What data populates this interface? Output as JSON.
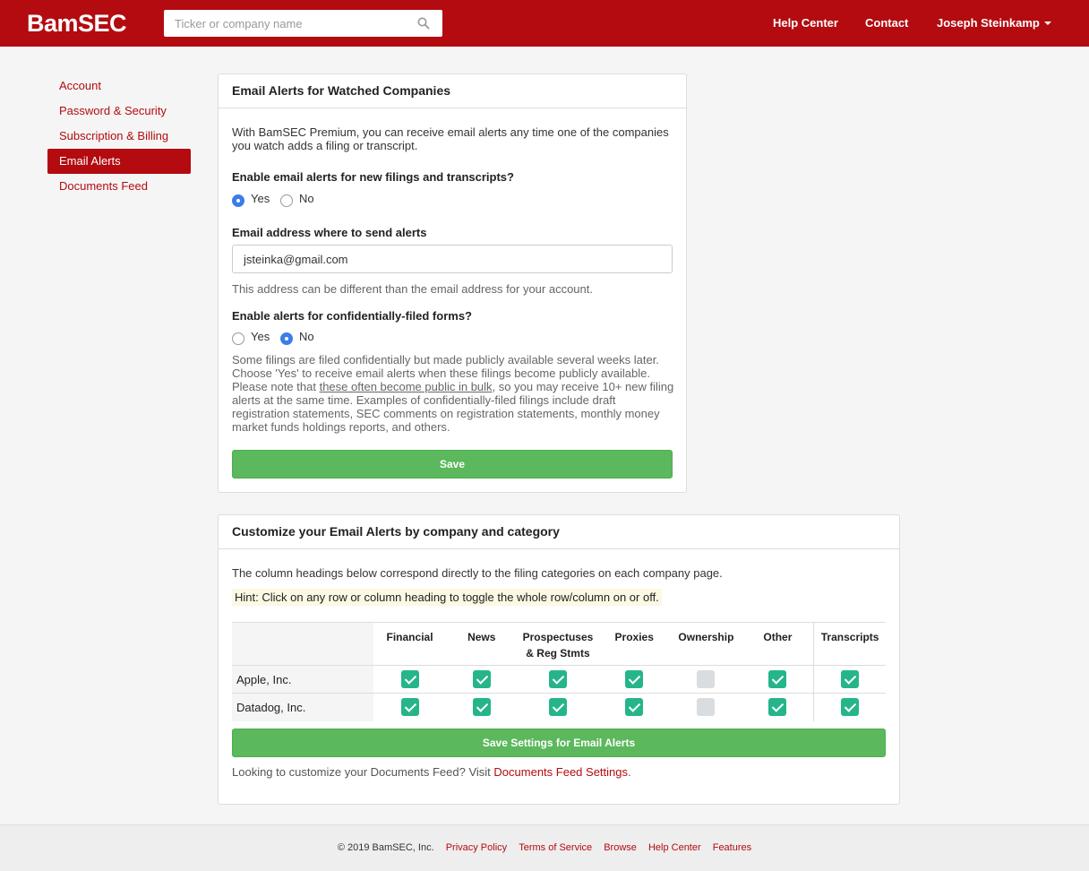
{
  "header": {
    "logo": "BamSEC",
    "search_placeholder": "Ticker or company name",
    "help_center": "Help Center",
    "contact": "Contact",
    "user_name": "Joseph Steinkamp"
  },
  "sidebar": {
    "items": [
      {
        "label": "Account"
      },
      {
        "label": "Password & Security"
      },
      {
        "label": "Subscription & Billing"
      },
      {
        "label": "Email Alerts"
      },
      {
        "label": "Documents Feed"
      }
    ]
  },
  "alerts_panel": {
    "title": "Email Alerts for Watched Companies",
    "intro": "With BamSEC Premium, you can receive email alerts any time one of the companies you watch adds a filing or transcript.",
    "enable_label": "Enable email alerts for new filings and transcripts?",
    "enable_yes": "Yes",
    "enable_no": "No",
    "email_label": "Email address where to send alerts",
    "email_value": "jsteinka@gmail.com",
    "email_help": "This address can be different than the email address for your account.",
    "confidential_label": "Enable alerts for confidentially-filed forms?",
    "confidential_yes": "Yes",
    "confidential_no": "No",
    "confidential_help_1": "Some filings are filed confidentially but made publicly available several weeks later. Choose 'Yes' to receive email alerts when these filings become publicly available. Please note that",
    "confidential_help_link": "these often become public in bulk",
    "confidential_help_2": ", so you may receive 10+ new filing alerts at the same time. Examples of confidentially-filed filings include draft registration statements, SEC comments on registration statements, monthly money market funds holdings reports, and others.",
    "save_label": "Save"
  },
  "customize_panel": {
    "title": "Customize your Email Alerts by company and category",
    "intro": "The column headings below correspond directly to the filing categories on each company page.",
    "hint": "Hint: Click on any row or column heading to toggle the whole row/column on or off.",
    "columns": [
      "Financial",
      "News",
      "Prospectuses",
      "& Reg Stmts",
      "Proxies",
      "Ownership",
      "Other",
      "Transcripts"
    ],
    "rows": [
      {
        "company": "Apple, Inc.",
        "checks": [
          true,
          true,
          true,
          true,
          false,
          true,
          true
        ]
      },
      {
        "company": "Datadog, Inc.",
        "checks": [
          true,
          true,
          true,
          true,
          false,
          true,
          true
        ]
      }
    ],
    "save_label": "Save Settings for Email Alerts",
    "feed_text": "Looking to customize your Documents Feed? Visit",
    "feed_link": "Documents Feed Settings",
    "feed_period": "."
  },
  "footer": {
    "copyright": "© 2019 BamSEC, Inc.",
    "links": [
      "Privacy Policy",
      "Terms of Service",
      "Browse",
      "Help Center",
      "Features"
    ]
  },
  "colors": {
    "brand_red": "#b30b10",
    "save_green": "#5cb85c",
    "check_green": "#26b58a",
    "radio_blue": "#3b7de9"
  }
}
